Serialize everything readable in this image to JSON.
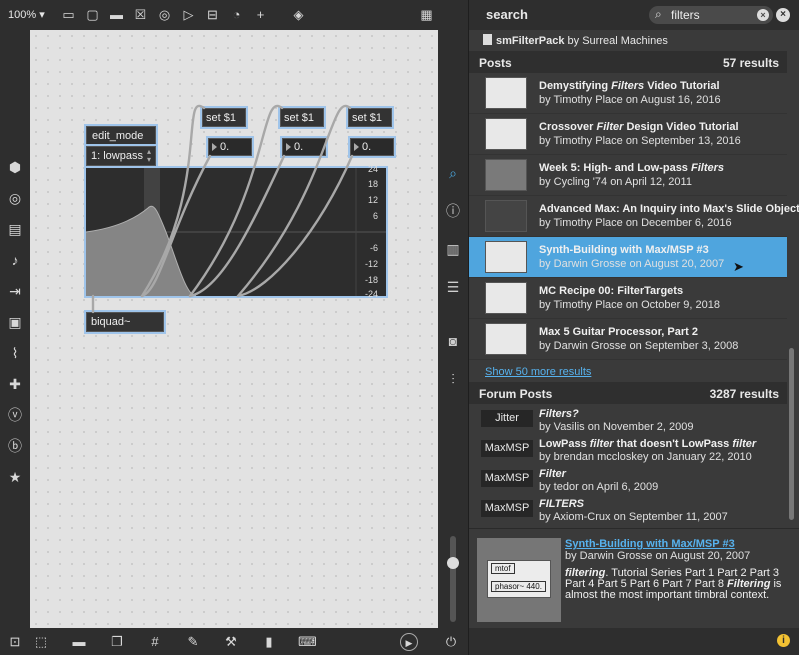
{
  "toolbar": {
    "zoom": "100%",
    "zoom_arrow": "▾"
  },
  "search": {
    "title": "search",
    "query": "filters"
  },
  "package": {
    "name": "smFilterPack",
    "author": "by Surreal Machines"
  },
  "posts": {
    "label": "Posts",
    "count": "57 results",
    "more": "Show 50 more results",
    "items": [
      {
        "pre": "Demystifying ",
        "em": "Filters",
        "post": " Video Tutorial",
        "sub": "by Timothy Place on August 16, 2016"
      },
      {
        "pre": "Crossover ",
        "em": "Filter",
        "post": " Design Video Tutorial",
        "sub": "by Timothy Place on September 13, 2016"
      },
      {
        "pre": "Week 5: High- and Low-pass ",
        "em": "Filters",
        "post": "",
        "sub": "by Cycling '74 on April 12, 2011"
      },
      {
        "pre": "Advanced Max: An Inquiry into Max's Slide Objects",
        "em": "",
        "post": "",
        "sub": "by Timothy Place on December 6, 2016"
      },
      {
        "pre": "Synth-Building with Max/MSP #3",
        "em": "",
        "post": "",
        "sub": "by Darwin Grosse on August 20, 2007"
      },
      {
        "pre": "MC Recipe 00: FilterTargets",
        "em": "",
        "post": "",
        "sub": "by Timothy Place on October 9, 2018"
      },
      {
        "pre": "Max 5 Guitar Processor, Part 2",
        "em": "",
        "post": "",
        "sub": "by Darwin Grosse on September 3, 2008"
      }
    ]
  },
  "forum": {
    "label": "Forum Posts",
    "count": "3287 results",
    "items": [
      {
        "tag": "Jitter",
        "pre": "",
        "em": "Filters?",
        "mid": "",
        "em2": "",
        "sub": "by Vasilis on November 2, 2009"
      },
      {
        "tag": "MaxMSP",
        "pre": "LowPass ",
        "em": "filter",
        "mid": " that doesn't LowPass ",
        "em2": "filter",
        "sub": "by brendan mccloskey on January 22, 2010"
      },
      {
        "tag": "MaxMSP",
        "pre": "",
        "em": "Filter",
        "mid": "",
        "em2": "",
        "sub": "by tedor on April 6, 2009"
      },
      {
        "tag": "MaxMSP",
        "pre": "",
        "em": "FILTERS",
        "mid": "",
        "em2": "",
        "sub": "by Axiom-Crux on September 11, 2007"
      }
    ]
  },
  "preview": {
    "title": "Synth-Building with Max/MSP #3",
    "sub": "by Darwin Grosse on August 20, 2007",
    "em1": "filtering",
    "desc1": ". Tutorial Series Part 1 Part 2 Part 3 Part 4 Part 5 Part 6 Part 7 Part 8 ",
    "em2": "Filtering",
    "desc2": " is almost the most important timbral context.",
    "thumb_line1": "mtof",
    "thumb_line2": "phasor~ 440."
  },
  "patch": {
    "edit_mode": "edit_mode",
    "menu_value": "1: lowpass",
    "set_label": "set $1",
    "num_value": "0.",
    "biquad": "biquad~",
    "scale": [
      "24",
      "18",
      "12",
      "6",
      "-6",
      "-12",
      "-18",
      "-24"
    ]
  },
  "colors": {
    "accent": "#4fa5de",
    "link": "#57b2ee",
    "selection": "#9fc4ea"
  }
}
